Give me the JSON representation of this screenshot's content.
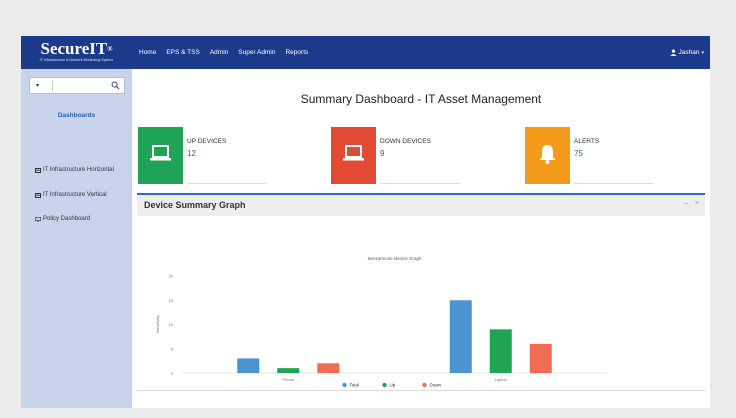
{
  "brand": {
    "name": "SecureIT",
    "sup": "®",
    "tagline": "IT Infrastructure & Network Monitoring System"
  },
  "nav": {
    "items": [
      "Home",
      "EPS & TSS",
      "Admin",
      "Super Admin",
      "Reports"
    ]
  },
  "user": {
    "name": "Jashan",
    "caret": "▾"
  },
  "sidebar": {
    "search": {
      "caret": "▾",
      "value": "",
      "placeholder": ""
    },
    "heading": "Dashboards",
    "items": [
      {
        "label": "IT Infrastructure Horizontal",
        "icon": "dashboard-icon"
      },
      {
        "label": "IT Infrastructure Vertical",
        "icon": "dashboard-icon"
      },
      {
        "label": "Policy Dashboard",
        "icon": "monitor-icon"
      }
    ]
  },
  "page": {
    "title": "Summary Dashboard - IT Asset Management"
  },
  "tiles": [
    {
      "label": "UP DEVICES",
      "value": "12",
      "color": "#1fa356",
      "icon": "laptop-icon"
    },
    {
      "label": "DOWN DEVICES",
      "value": "9",
      "color": "#e24a33",
      "icon": "laptop-icon"
    },
    {
      "label": "ALERTS",
      "value": "75",
      "color": "#f49b1c",
      "icon": "bell-icon"
    }
  ],
  "panel": {
    "title": "Device Summary Graph",
    "minimize": "–",
    "close": "×"
  },
  "chart_data": {
    "type": "bar",
    "title": "Sensorscore Device Graph",
    "ylabel": "Sensitivity",
    "ylim": [
      0,
      20
    ],
    "yticks": [
      0,
      5,
      10,
      15,
      20
    ],
    "categories": [
      "Phone",
      "Laptop"
    ],
    "series": [
      {
        "name": "Total",
        "color": "#4b94cf",
        "values": [
          3,
          15
        ]
      },
      {
        "name": "Up",
        "color": "#1fa356",
        "values": [
          1,
          9
        ]
      },
      {
        "name": "Down",
        "color": "#f06c52",
        "values": [
          2,
          6
        ]
      }
    ],
    "legend": "bottom-center",
    "grid": false
  }
}
